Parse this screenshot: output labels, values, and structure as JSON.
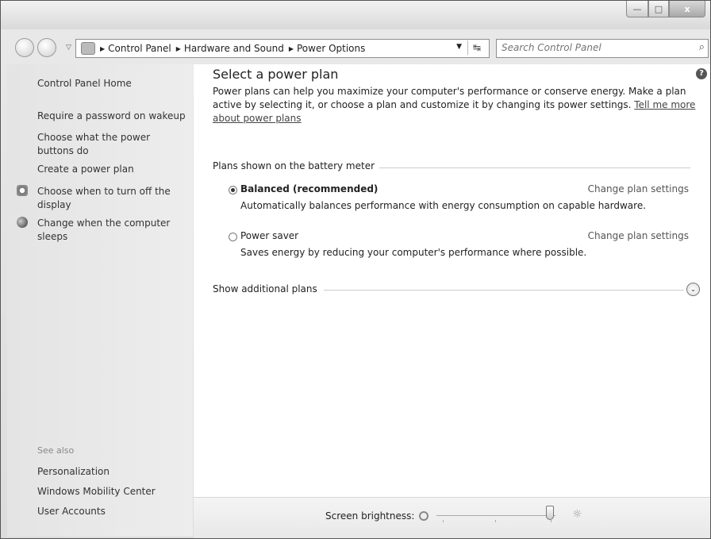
{
  "window": {
    "caption_buttons": {
      "minimize": "—",
      "maximize": "□",
      "close": "x"
    }
  },
  "address": {
    "crumbs": [
      "Control Panel",
      "Hardware and Sound",
      "Power Options"
    ],
    "search_placeholder": "Search Control Panel"
  },
  "sidebar": {
    "home": "Control Panel Home",
    "links": [
      "Require a password on wakeup",
      "Choose what the power buttons do",
      "Create a power plan",
      "Choose when to turn off the display",
      "Change when the computer sleeps"
    ],
    "see_also_label": "See also",
    "see_also": [
      "Personalization",
      "Windows Mobility Center",
      "User Accounts"
    ]
  },
  "main": {
    "title": "Select a power plan",
    "description": "Power plans can help you maximize your computer's performance or conserve energy. Make a plan active by selecting it, or choose a plan and customize it by changing its power settings. ",
    "description_link": "Tell me more about power plans",
    "group_label": "Plans shown on the battery meter",
    "plans": [
      {
        "name": "Balanced (recommended)",
        "selected": true,
        "link": "Change plan settings",
        "desc": "Automatically balances performance with energy consumption on capable hardware."
      },
      {
        "name": "Power saver",
        "selected": false,
        "link": "Change plan settings",
        "desc": "Saves energy by reducing your computer's performance where possible."
      }
    ],
    "show_additional": "Show additional plans"
  },
  "brightness": {
    "label": "Screen brightness:",
    "value_percent": 95
  }
}
